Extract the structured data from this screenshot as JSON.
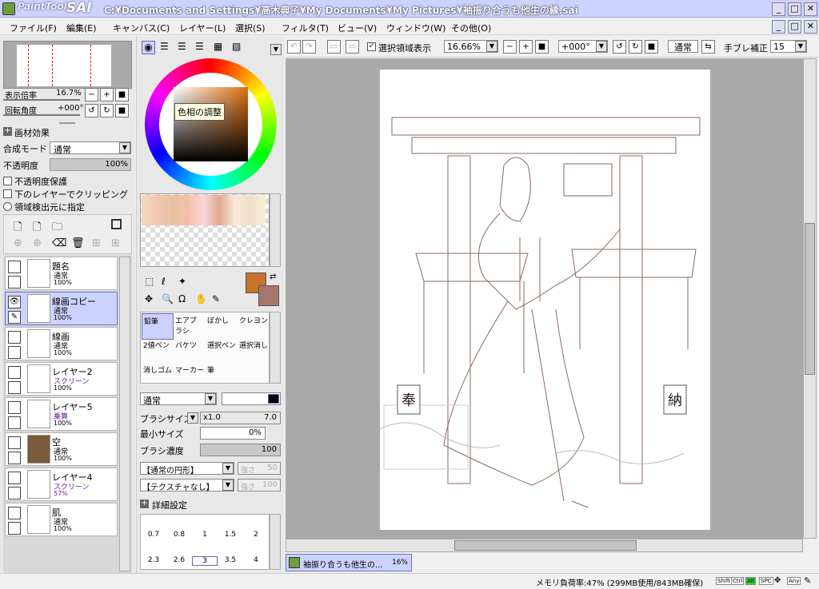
{
  "titlebar": {
    "logo": "PaintTool",
    "logo_sai": "SAI",
    "title": "C:¥Documents and Settings¥高木典子¥My Documents¥My Pictures¥袖振り合うも他生の縁.sai"
  },
  "menu": [
    "ファイル(F)",
    "編集(E)",
    "キャンバス(C)",
    "レイヤー(L)",
    "選択(S)",
    "フィルタ(T)",
    "ビュー(V)",
    "ウィンドウ(W)",
    "その他(O)"
  ],
  "navigator": {
    "zoom_label": "表示倍率",
    "zoom_value": "16.7%",
    "rotate_label": "回転角度",
    "rotate_value": "+000°"
  },
  "layer_props": {
    "effects": "画材効果",
    "blend_label": "合成モード",
    "blend_value": "通常",
    "opacity_label": "不透明度",
    "opacity_value": "100%",
    "protect": "不透明度保護",
    "clip": "下のレイヤーでクリッピング",
    "source": "領域検出元に指定"
  },
  "layers": [
    {
      "name": "題名",
      "mode": "通常",
      "opacity": "100%"
    },
    {
      "name": "線画コピー",
      "mode": "通常",
      "opacity": "100%"
    },
    {
      "name": "線画",
      "mode": "通常",
      "opacity": "100%"
    },
    {
      "name": "レイヤー2",
      "mode": "スクリーン",
      "opacity": "100%"
    },
    {
      "name": "レイヤー5",
      "mode": "乗算",
      "opacity": "100%"
    },
    {
      "name": "空",
      "mode": "通常",
      "opacity": "100%"
    },
    {
      "name": "レイヤー4",
      "mode": "スクリーン",
      "opacity": "57%"
    },
    {
      "name": "肌",
      "mode": "通常",
      "opacity": "100%"
    }
  ],
  "color": {
    "tooltip": "色相の調整",
    "fg": "#c8722c",
    "bg": "#a7766a"
  },
  "tools": [
    [
      "鉛筆",
      "エアブラシ",
      "ぼかし",
      "クレヨン"
    ],
    [
      "2値ペン",
      "バケツ",
      "選択ペン",
      "選択消し"
    ],
    [
      "消しゴム",
      "マーカー",
      "筆",
      ""
    ]
  ],
  "brush": {
    "mode": "通常",
    "size_label": "ブラシサイズ",
    "size_mult": "x1.0",
    "size_value": "7.0",
    "min_label": "最小サイズ",
    "min_value": "0%",
    "density_label": "ブラシ濃度",
    "density_value": "100",
    "shape": "【通常の円形】",
    "shape_strength_label": "強さ",
    "shape_strength": "50",
    "texture": "【テクスチャなし】",
    "texture_strength_label": "強さ",
    "texture_strength": "100",
    "detail": "詳細設定",
    "sizes_row1": [
      "0.7",
      "0.8",
      "1",
      "1.5",
      "2"
    ],
    "sizes_row2": [
      "2.3",
      "2.6",
      "3",
      "3.5",
      "4"
    ]
  },
  "toolbar": {
    "show_selection": "選択領域表示",
    "zoom": "16.66%",
    "angle": "+000°",
    "mode": "通常",
    "stabilizer_label": "手ブレ補正",
    "stabilizer_value": "15"
  },
  "canvas": {
    "sign_left": "奉",
    "sign_right": "納"
  },
  "taskbar": {
    "doc_name": "袖振り合うも他生の...",
    "doc_zoom": "16%"
  },
  "status": {
    "memory": "メモリ負荷率:47% (299MB使用/843MB確保)",
    "keys": [
      "Shift",
      "Ctrl",
      "Alt",
      "SPC",
      "Any"
    ]
  }
}
